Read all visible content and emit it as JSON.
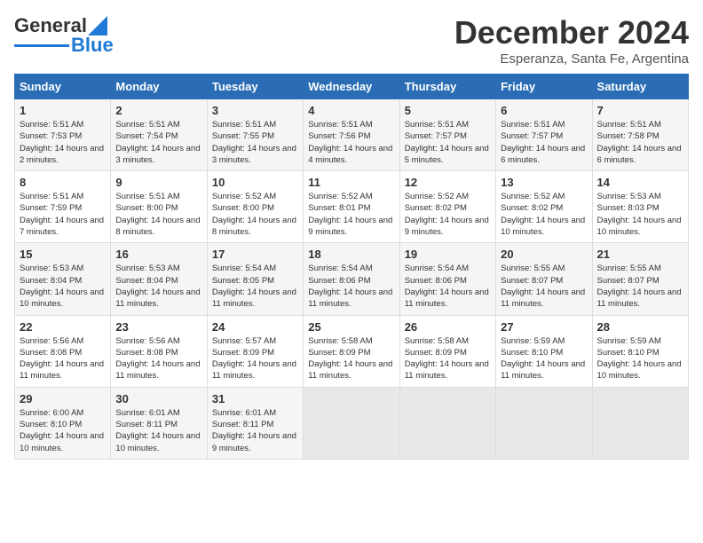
{
  "header": {
    "logo_general": "General",
    "logo_blue": "Blue",
    "month_title": "December 2024",
    "location": "Esperanza, Santa Fe, Argentina"
  },
  "calendar": {
    "days_of_week": [
      "Sunday",
      "Monday",
      "Tuesday",
      "Wednesday",
      "Thursday",
      "Friday",
      "Saturday"
    ],
    "weeks": [
      [
        {
          "day": "",
          "empty": true
        },
        {
          "day": "",
          "empty": true
        },
        {
          "day": "",
          "empty": true
        },
        {
          "day": "",
          "empty": true
        },
        {
          "day": "",
          "empty": true
        },
        {
          "day": "",
          "empty": true
        },
        {
          "day": "",
          "empty": true
        }
      ],
      [
        {
          "day": "1",
          "sunrise": "5:51 AM",
          "sunset": "7:53 PM",
          "daylight": "14 hours and 2 minutes."
        },
        {
          "day": "2",
          "sunrise": "5:51 AM",
          "sunset": "7:54 PM",
          "daylight": "14 hours and 3 minutes."
        },
        {
          "day": "3",
          "sunrise": "5:51 AM",
          "sunset": "7:55 PM",
          "daylight": "14 hours and 3 minutes."
        },
        {
          "day": "4",
          "sunrise": "5:51 AM",
          "sunset": "7:56 PM",
          "daylight": "14 hours and 4 minutes."
        },
        {
          "day": "5",
          "sunrise": "5:51 AM",
          "sunset": "7:57 PM",
          "daylight": "14 hours and 5 minutes."
        },
        {
          "day": "6",
          "sunrise": "5:51 AM",
          "sunset": "7:57 PM",
          "daylight": "14 hours and 6 minutes."
        },
        {
          "day": "7",
          "sunrise": "5:51 AM",
          "sunset": "7:58 PM",
          "daylight": "14 hours and 6 minutes."
        }
      ],
      [
        {
          "day": "8",
          "sunrise": "5:51 AM",
          "sunset": "7:59 PM",
          "daylight": "14 hours and 7 minutes."
        },
        {
          "day": "9",
          "sunrise": "5:51 AM",
          "sunset": "8:00 PM",
          "daylight": "14 hours and 8 minutes."
        },
        {
          "day": "10",
          "sunrise": "5:52 AM",
          "sunset": "8:00 PM",
          "daylight": "14 hours and 8 minutes."
        },
        {
          "day": "11",
          "sunrise": "5:52 AM",
          "sunset": "8:01 PM",
          "daylight": "14 hours and 9 minutes."
        },
        {
          "day": "12",
          "sunrise": "5:52 AM",
          "sunset": "8:02 PM",
          "daylight": "14 hours and 9 minutes."
        },
        {
          "day": "13",
          "sunrise": "5:52 AM",
          "sunset": "8:02 PM",
          "daylight": "14 hours and 10 minutes."
        },
        {
          "day": "14",
          "sunrise": "5:53 AM",
          "sunset": "8:03 PM",
          "daylight": "14 hours and 10 minutes."
        }
      ],
      [
        {
          "day": "15",
          "sunrise": "5:53 AM",
          "sunset": "8:04 PM",
          "daylight": "14 hours and 10 minutes."
        },
        {
          "day": "16",
          "sunrise": "5:53 AM",
          "sunset": "8:04 PM",
          "daylight": "14 hours and 11 minutes."
        },
        {
          "day": "17",
          "sunrise": "5:54 AM",
          "sunset": "8:05 PM",
          "daylight": "14 hours and 11 minutes."
        },
        {
          "day": "18",
          "sunrise": "5:54 AM",
          "sunset": "8:06 PM",
          "daylight": "14 hours and 11 minutes."
        },
        {
          "day": "19",
          "sunrise": "5:54 AM",
          "sunset": "8:06 PM",
          "daylight": "14 hours and 11 minutes."
        },
        {
          "day": "20",
          "sunrise": "5:55 AM",
          "sunset": "8:07 PM",
          "daylight": "14 hours and 11 minutes."
        },
        {
          "day": "21",
          "sunrise": "5:55 AM",
          "sunset": "8:07 PM",
          "daylight": "14 hours and 11 minutes."
        }
      ],
      [
        {
          "day": "22",
          "sunrise": "5:56 AM",
          "sunset": "8:08 PM",
          "daylight": "14 hours and 11 minutes."
        },
        {
          "day": "23",
          "sunrise": "5:56 AM",
          "sunset": "8:08 PM",
          "daylight": "14 hours and 11 minutes."
        },
        {
          "day": "24",
          "sunrise": "5:57 AM",
          "sunset": "8:09 PM",
          "daylight": "14 hours and 11 minutes."
        },
        {
          "day": "25",
          "sunrise": "5:58 AM",
          "sunset": "8:09 PM",
          "daylight": "14 hours and 11 minutes."
        },
        {
          "day": "26",
          "sunrise": "5:58 AM",
          "sunset": "8:09 PM",
          "daylight": "14 hours and 11 minutes."
        },
        {
          "day": "27",
          "sunrise": "5:59 AM",
          "sunset": "8:10 PM",
          "daylight": "14 hours and 11 minutes."
        },
        {
          "day": "28",
          "sunrise": "5:59 AM",
          "sunset": "8:10 PM",
          "daylight": "14 hours and 10 minutes."
        }
      ],
      [
        {
          "day": "29",
          "sunrise": "6:00 AM",
          "sunset": "8:10 PM",
          "daylight": "14 hours and 10 minutes."
        },
        {
          "day": "30",
          "sunrise": "6:01 AM",
          "sunset": "8:11 PM",
          "daylight": "14 hours and 10 minutes."
        },
        {
          "day": "31",
          "sunrise": "6:01 AM",
          "sunset": "8:11 PM",
          "daylight": "14 hours and 9 minutes."
        },
        {
          "day": "",
          "empty": true
        },
        {
          "day": "",
          "empty": true
        },
        {
          "day": "",
          "empty": true
        },
        {
          "day": "",
          "empty": true
        }
      ]
    ]
  }
}
